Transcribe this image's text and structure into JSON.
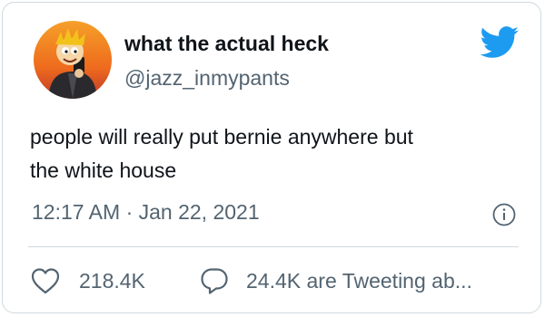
{
  "tweet": {
    "display_name": "what the actual heck",
    "handle": "@jazz_inmypants",
    "text_line1": "people will really put bernie anywhere but",
    "text_line2": "the white house",
    "timestamp": "12:17 AM · Jan 22, 2021"
  },
  "actions": {
    "likes": "218.4K",
    "tweeting": "24.4K are Tweeting ab..."
  },
  "colors": {
    "twitter_blue": "#1d9bf0",
    "text_primary": "#0f1419",
    "text_secondary": "#536471",
    "border": "#cfd9de"
  },
  "icons": {
    "brand": "twitter-bird-icon",
    "info": "info-icon",
    "like": "heart-icon",
    "reply": "speech-bubble-icon"
  }
}
